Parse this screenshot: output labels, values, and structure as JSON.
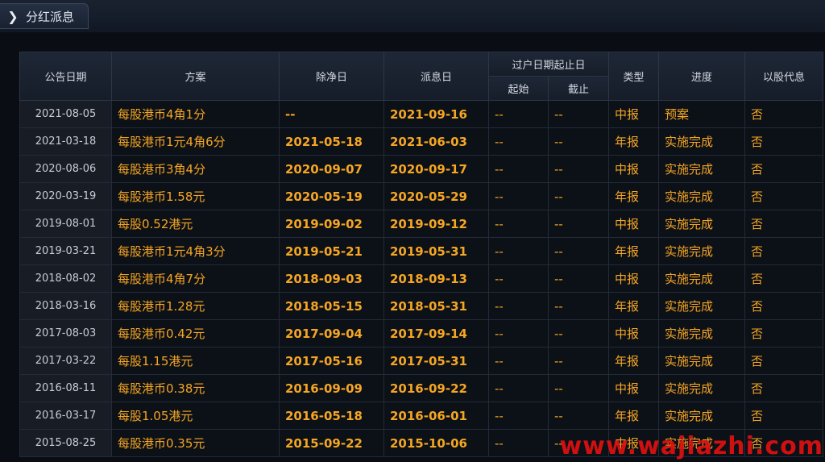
{
  "tab": {
    "icon": "chevron-right-icon",
    "label": "分红派息"
  },
  "table": {
    "headers": {
      "announce_date": "公告日期",
      "plan": "方案",
      "ex_date": "除净日",
      "pay_date": "派息日",
      "transfer_group": "过户日期起止日",
      "transfer_start": "起始",
      "transfer_end": "截止",
      "type": "类型",
      "progress": "进度",
      "scrip": "以股代息"
    },
    "rows": [
      [
        "2021-08-05",
        "每股港币4角1分",
        "--",
        "2021-09-16",
        "--",
        "--",
        "中报",
        "预案",
        "否"
      ],
      [
        "2021-03-18",
        "每股港币1元4角6分",
        "2021-05-18",
        "2021-06-03",
        "--",
        "--",
        "年报",
        "实施完成",
        "否"
      ],
      [
        "2020-08-06",
        "每股港币3角4分",
        "2020-09-07",
        "2020-09-17",
        "--",
        "--",
        "中报",
        "实施完成",
        "否"
      ],
      [
        "2020-03-19",
        "每股港币1.58元",
        "2020-05-19",
        "2020-05-29",
        "--",
        "--",
        "年报",
        "实施完成",
        "否"
      ],
      [
        "2019-08-01",
        "每股0.52港元",
        "2019-09-02",
        "2019-09-12",
        "--",
        "--",
        "中报",
        "实施完成",
        "否"
      ],
      [
        "2019-03-21",
        "每股港币1元4角3分",
        "2019-05-21",
        "2019-05-31",
        "--",
        "--",
        "年报",
        "实施完成",
        "否"
      ],
      [
        "2018-08-02",
        "每股港币4角7分",
        "2018-09-03",
        "2018-09-13",
        "--",
        "--",
        "中报",
        "实施完成",
        "否"
      ],
      [
        "2018-03-16",
        "每股港币1.28元",
        "2018-05-15",
        "2018-05-31",
        "--",
        "--",
        "年报",
        "实施完成",
        "否"
      ],
      [
        "2017-08-03",
        "每股港币0.42元",
        "2017-09-04",
        "2017-09-14",
        "--",
        "--",
        "中报",
        "实施完成",
        "否"
      ],
      [
        "2017-03-22",
        "每股1.15港元",
        "2017-05-16",
        "2017-05-31",
        "--",
        "--",
        "年报",
        "实施完成",
        "否"
      ],
      [
        "2016-08-11",
        "每股港币0.38元",
        "2016-09-09",
        "2016-09-22",
        "--",
        "--",
        "中报",
        "实施完成",
        "否"
      ],
      [
        "2016-03-17",
        "每股1.05港元",
        "2016-05-18",
        "2016-06-01",
        "--",
        "--",
        "年报",
        "实施完成",
        "否"
      ],
      [
        "2015-08-25",
        "每股港币0.35元",
        "2015-09-22",
        "2015-10-06",
        "--",
        "--",
        "中报",
        "实施完成",
        "否"
      ]
    ]
  },
  "watermark": "www.wajiazhi.com",
  "colors": {
    "background": "#0a0d14",
    "value_text": "#f5a623",
    "date_text": "#c7ccd4",
    "header_text": "#d4d9e2",
    "watermark": "#e01010"
  }
}
